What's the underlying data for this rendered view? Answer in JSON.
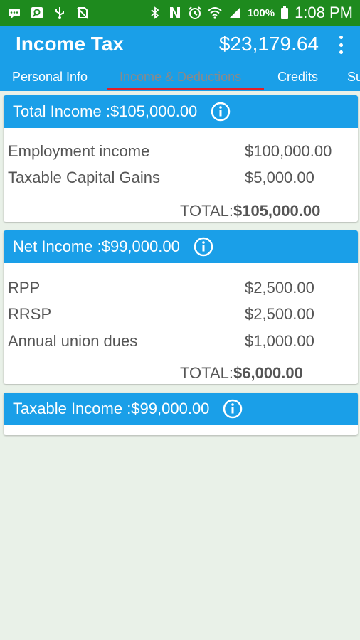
{
  "status_bar": {
    "battery_pct": "100%",
    "time": "1:08 PM"
  },
  "app": {
    "title": "Income Tax",
    "balance": "$23,179.64"
  },
  "tabs": [
    {
      "label": "Personal Info"
    },
    {
      "label": "Income & Deductions"
    },
    {
      "label": "Credits"
    },
    {
      "label": "Su"
    }
  ],
  "cards": {
    "total_income": {
      "header": "Total Income :$105,000.00",
      "rows": [
        {
          "label": "Employment income",
          "amount": "$100,000.00"
        },
        {
          "label": "Taxable Capital Gains",
          "amount": "$5,000.00"
        }
      ],
      "total_label": "TOTAL:",
      "total_value": "$105,000.00"
    },
    "net_income": {
      "header": "Net Income :$99,000.00",
      "rows": [
        {
          "label": "RPP",
          "amount": "$2,500.00"
        },
        {
          "label": "RRSP",
          "amount": "$2,500.00"
        },
        {
          "label": "Annual union dues",
          "amount": "$1,000.00"
        }
      ],
      "total_label": "TOTAL:",
      "total_value": "$6,000.00"
    },
    "taxable_income": {
      "header": "Taxable Income :$99,000.00"
    }
  },
  "colors": {
    "status_bar": "#1e8a1e",
    "primary": "#1a9fe8",
    "tab_indicator": "#e0202a",
    "background": "#e9f1e8"
  }
}
